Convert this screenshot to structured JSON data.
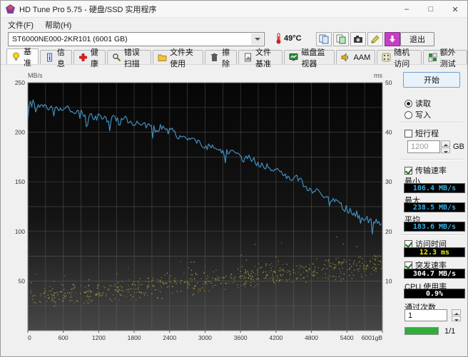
{
  "window": {
    "title": "HD Tune Pro 5.75 - 硬盘/SSD 实用程序",
    "controls": {
      "minimize": "–",
      "maximize": "□",
      "close": "✕"
    }
  },
  "menu": {
    "items": [
      {
        "label": "文件(F)"
      },
      {
        "label": "帮助(H)"
      }
    ]
  },
  "toolbar": {
    "drive": "ST6000NE000-2KR101 (6001 GB)",
    "temperature": "49°C",
    "exit_label": "退出",
    "icons": [
      "copy-icon",
      "copy-export-icon",
      "camera-icon",
      "highlight-icon",
      "save-download-icon"
    ]
  },
  "tabs": [
    {
      "label": "基准",
      "icon": "lightbulb-icon",
      "active": true
    },
    {
      "label": "信息",
      "icon": "info-icon"
    },
    {
      "label": "健康",
      "icon": "health-cross-icon"
    },
    {
      "label": "错误扫描",
      "icon": "magnifier-icon"
    },
    {
      "label": "文件夹使用",
      "icon": "folder-icon"
    },
    {
      "label": "擦除",
      "icon": "trash-icon"
    },
    {
      "label": "文件基准",
      "icon": "file-benchmark-icon"
    },
    {
      "label": "磁盘监视器",
      "icon": "disk-monitor-icon"
    },
    {
      "label": "AAM",
      "icon": "speaker-icon"
    },
    {
      "label": "随机访问",
      "icon": "random-access-icon"
    },
    {
      "label": "额外测试",
      "icon": "extra-tests-icon"
    }
  ],
  "panel": {
    "start_label": "开始",
    "read_label": "读取",
    "write_label": "写入",
    "short_stroke_label": "短行程",
    "short_stroke_value": "1200",
    "short_stroke_unit": "GB",
    "transfer_label": "传输速率",
    "min_label": "最小",
    "min_value": "106.4 MB/s",
    "max_label": "最大",
    "max_value": "238.5 MB/s",
    "avg_label": "平均",
    "avg_value": "183.6 MB/s",
    "access_label": "访问时间",
    "access_value": "12.3 ms",
    "burst_label": "突发速率",
    "burst_value": "304.7 MB/s",
    "cpu_label": "CPU 使用率",
    "cpu_value": "0.9%",
    "pass_label": "通过次数",
    "pass_value": "1",
    "progress_text": "1/1"
  },
  "chart_data": {
    "type": "line",
    "title": "",
    "left_axis": {
      "label": "MB/s",
      "min": 0,
      "max": 250,
      "ticks": [
        50,
        100,
        150,
        200,
        250
      ]
    },
    "right_axis": {
      "label": "ms",
      "min": 0,
      "max": 50,
      "ticks": [
        10,
        20,
        30,
        40,
        50
      ]
    },
    "x_axis": {
      "min": 0,
      "max": 6001,
      "grid_step": 300,
      "tick_labels": [
        "0",
        "600",
        "1200",
        "1800",
        "2400",
        "3000",
        "3600",
        "4200",
        "4800",
        "5400",
        "6001gB"
      ]
    },
    "grid": true,
    "colors": {
      "line": "#4596c8",
      "scatter": "#b3a33c",
      "plot_bg_top": "#060606",
      "plot_bg_bottom": "#474747"
    },
    "series": [
      {
        "name": "transfer_rate",
        "unit": "MB/s",
        "axis": "left",
        "x": [
          0,
          60,
          150,
          250,
          350,
          450,
          550,
          650,
          750,
          850,
          950,
          1050,
          1150,
          1250,
          1350,
          1450,
          1550,
          1650,
          1750,
          1850,
          1950,
          2050,
          2150,
          2250,
          2350,
          2450,
          2550,
          2650,
          2750,
          2850,
          2950,
          3050,
          3150,
          3250,
          3350,
          3450,
          3550,
          3650,
          3750,
          3850,
          3950,
          4050,
          4150,
          4250,
          4350,
          4450,
          4550,
          4650,
          4750,
          4850,
          4950,
          5050,
          5150,
          5250,
          5350,
          5450,
          5550,
          5650,
          5750,
          5850,
          5950,
          6001
        ],
        "values": [
          224,
          231,
          227,
          230,
          224,
          228,
          222,
          226,
          220,
          224,
          217,
          219,
          214,
          217,
          212,
          215,
          210,
          213,
          208,
          210,
          206,
          208,
          203,
          205,
          200,
          202,
          196,
          193,
          195,
          190,
          187,
          185,
          187,
          182,
          179,
          181,
          176,
          172,
          174,
          170,
          167,
          165,
          162,
          163,
          158,
          152,
          154,
          149,
          144,
          141,
          138,
          134,
          131,
          129,
          124,
          121,
          118,
          115,
          112,
          110,
          108,
          107
        ]
      },
      {
        "name": "access_time_scatter",
        "unit": "ms",
        "axis": "right",
        "band": {
          "x_start": 0,
          "x_end": 6001,
          "ms_center_start": 6.5,
          "ms_center_end": 13.5,
          "ms_spread": 3.2,
          "points": 700
        }
      }
    ],
    "stats": {
      "min": "106.4 MB/s",
      "max": "238.5 MB/s",
      "avg": "183.6 MB/s",
      "access_time": "12.3 ms",
      "burst_rate": "304.7 MB/s",
      "cpu_usage": "0.9%"
    }
  }
}
